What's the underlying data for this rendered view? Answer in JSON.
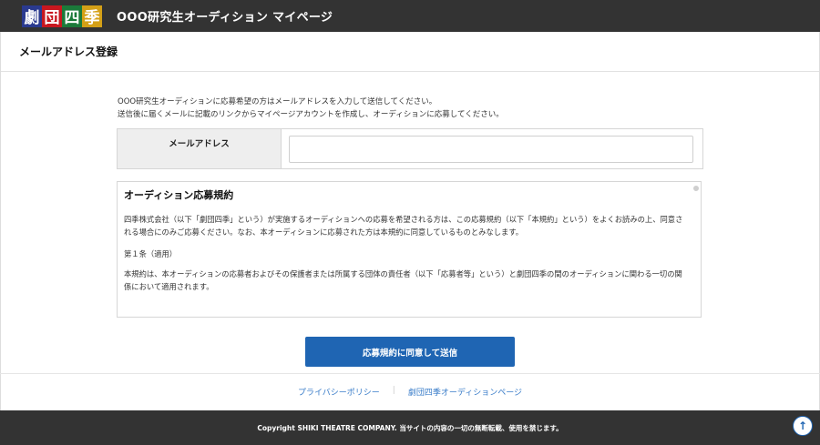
{
  "header": {
    "logo": [
      "劇",
      "団",
      "四",
      "季"
    ],
    "title": "OOO研究生オーディション マイページ"
  },
  "page": {
    "heading": "メールアドレス登録"
  },
  "intro": {
    "line1": "OOO研究生オーディションに応募希望の方はメールアドレスを入力して送信してください。",
    "line2": "送信後に届くメールに記載のリンクからマイページアカウントを作成し、オーディションに応募してください。"
  },
  "form": {
    "email_label": "メールアドレス",
    "email_value": "",
    "email_placeholder": ""
  },
  "terms": {
    "title": "オーディション応募規約",
    "para1": "四季株式会社（以下「劇団四季」という）が実施するオーディションへの応募を希望される方は、この応募規約（以下「本規約」という）をよくお読みの上、同意される場合にのみご応募ください。なお、本オーディションに応募された方は本規約に同意しているものとみなします。",
    "article1": "第１条（適用）",
    "para2": "本規約は、本オーディションの応募者およびその保護者または所属する団体の責任者（以下「応募者等」という）と劇団四季の間のオーディションに関わる一切の関係において適用されます。"
  },
  "submit_label": "応募規約に同意して送信",
  "footer": {
    "link_privacy": "プライバシーポリシー",
    "link_audition": "劇団四季オーディションページ",
    "copyright": "Copyright SHIKI THEATRE COMPANY. 当サイトの内容の一切の無断転載、使用を禁じます。"
  },
  "icons": {
    "back_to_top": "arrow-up-icon",
    "back_to_top_glyph": "↑"
  },
  "colors": {
    "header_bg": "#333333",
    "primary_button": "#1f65b3",
    "link": "#3a7dc9"
  }
}
